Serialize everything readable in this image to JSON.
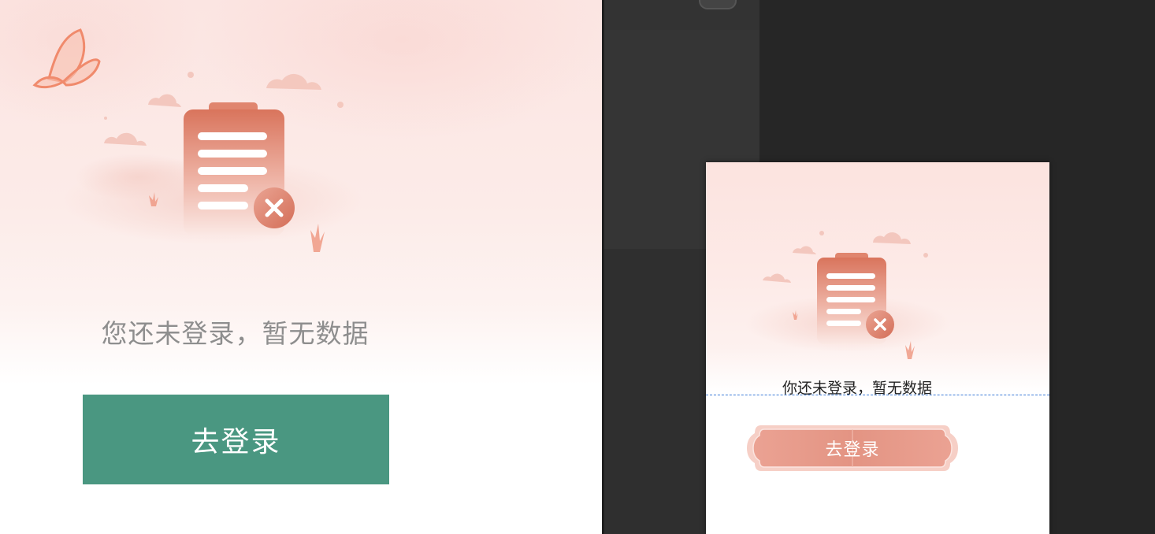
{
  "mobile_preview": {
    "empty_text": "您还未登录，暂无数据",
    "login_button": "去登录",
    "button_color": "#4a9781",
    "illustration_icons": [
      "butterfly-icon",
      "clipboard-icon",
      "close-icon",
      "cloud-icon"
    ]
  },
  "design_preview": {
    "empty_text": "你还未登录，暂无数据",
    "login_button": "去登录",
    "button_color": "#e7988a",
    "accent_color": "#d9826f"
  }
}
